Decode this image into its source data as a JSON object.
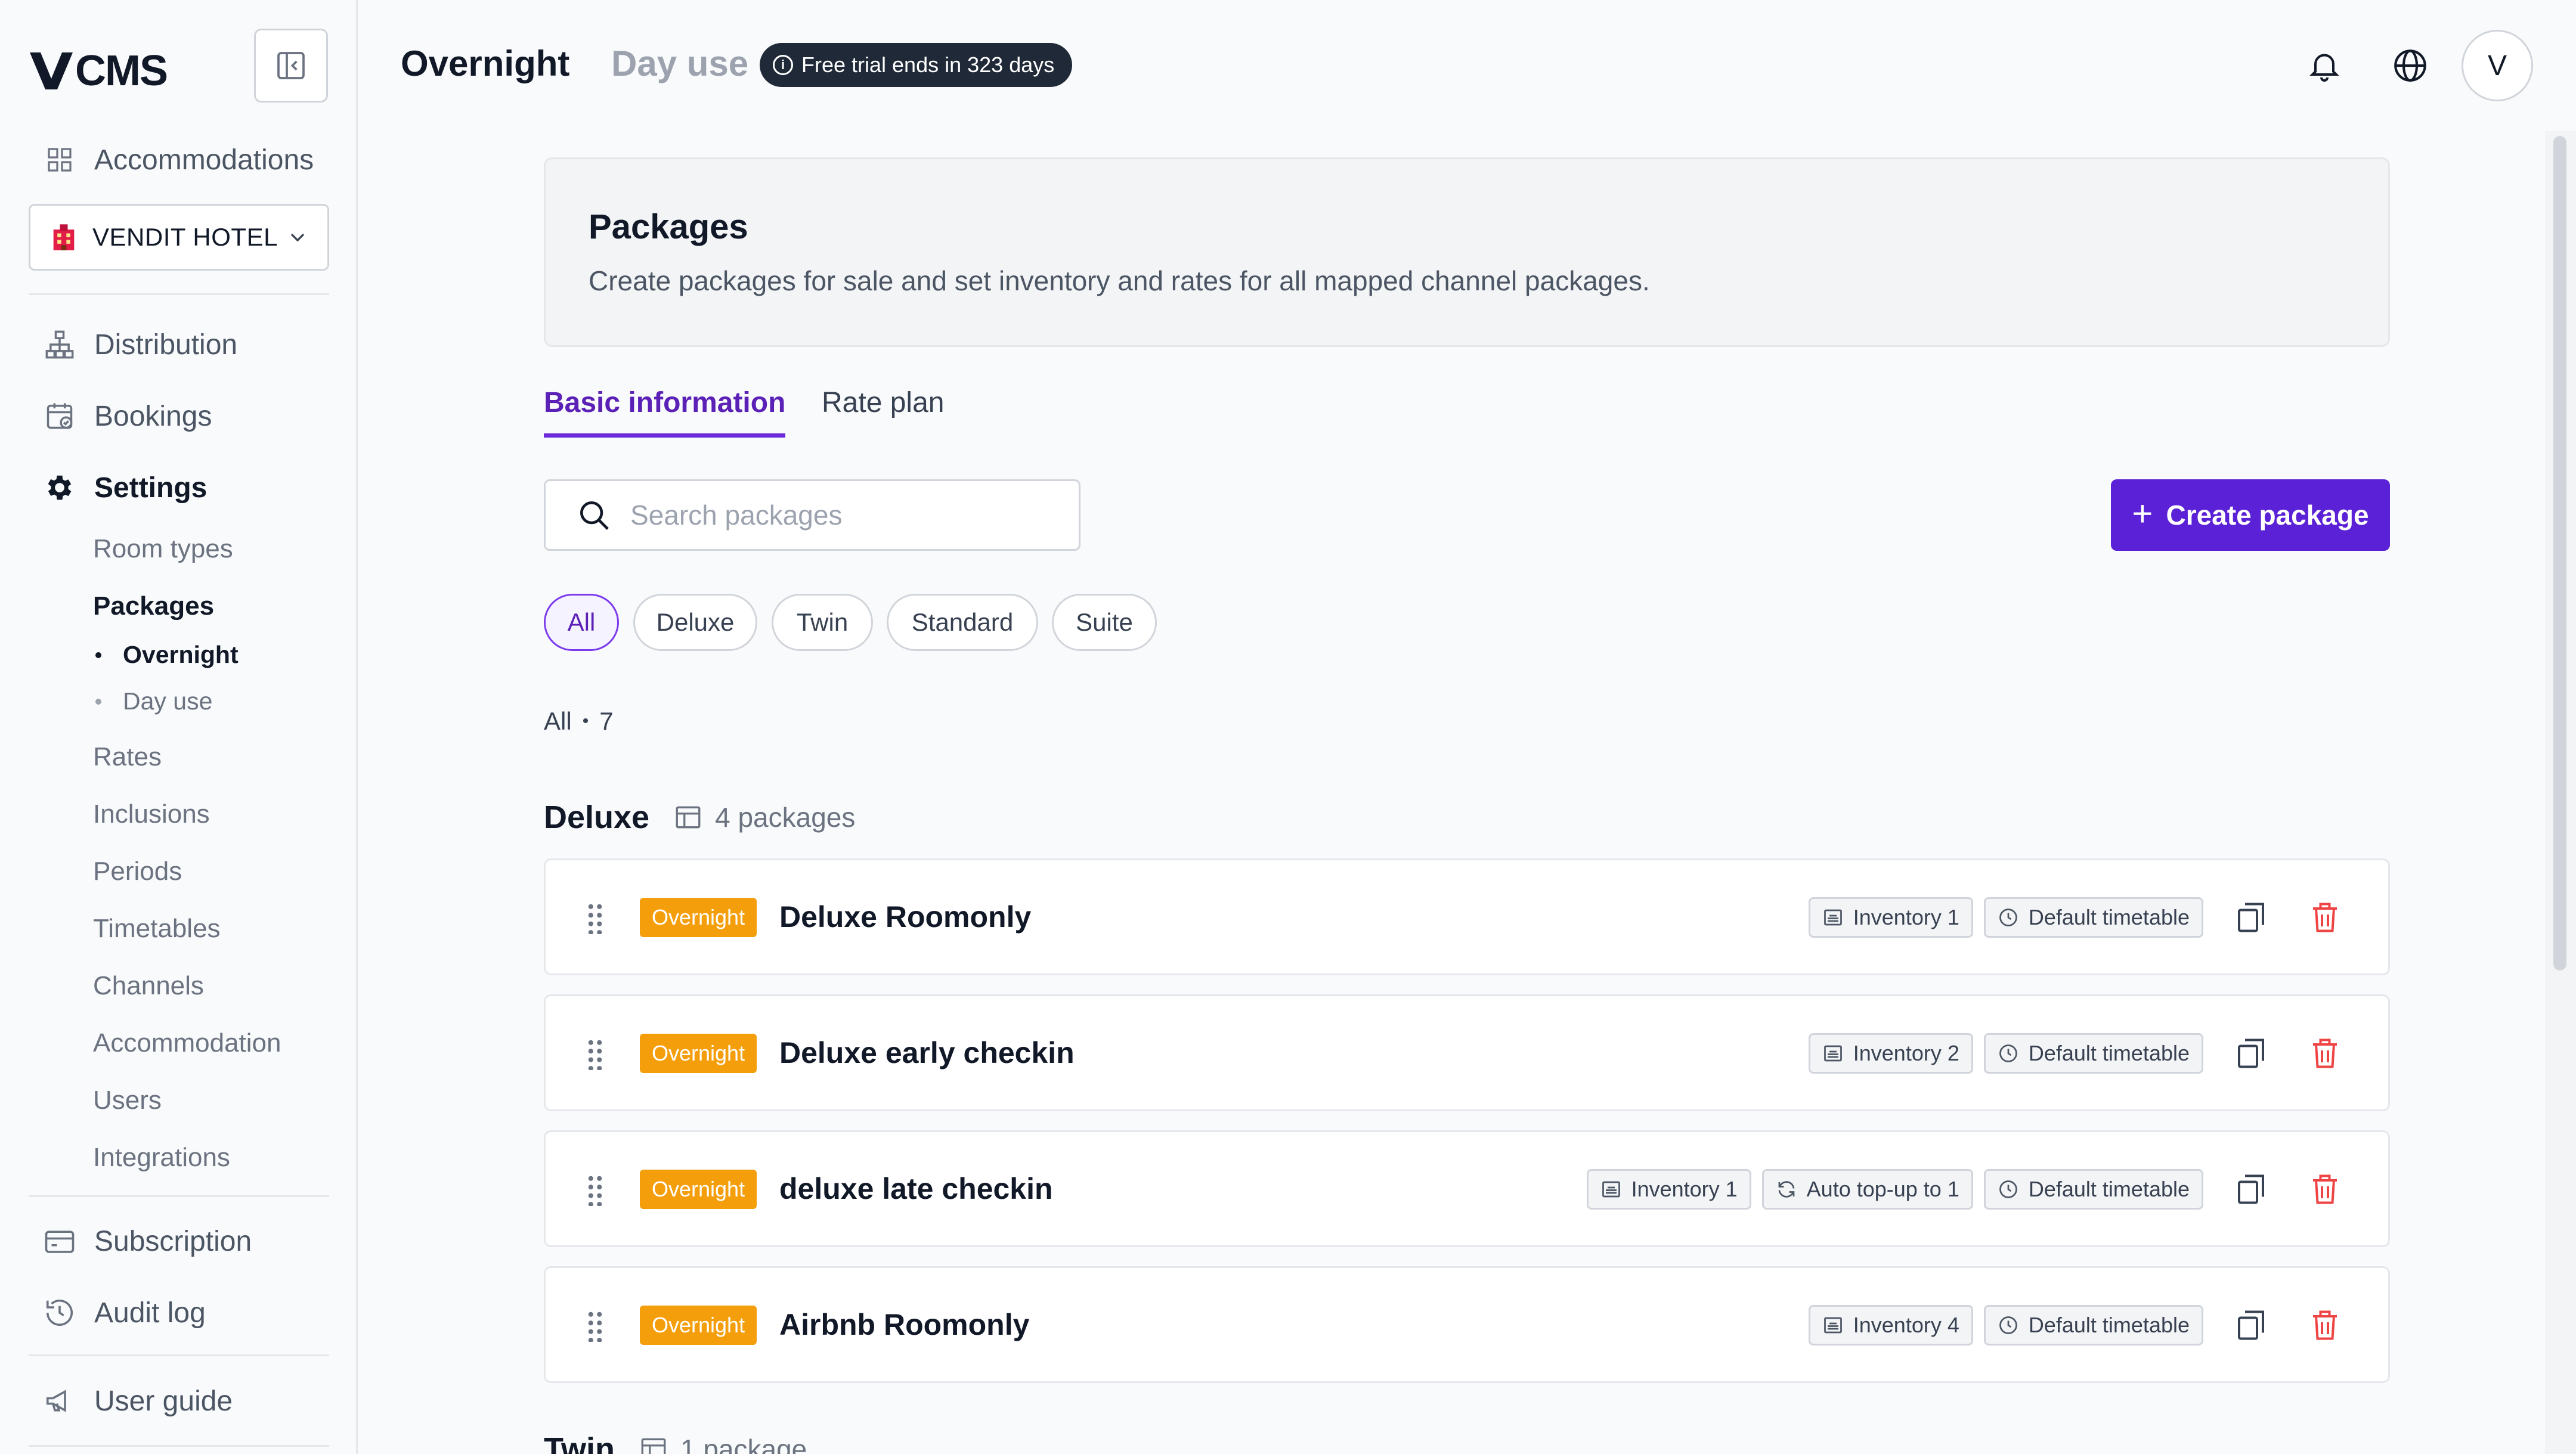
{
  "app": {
    "logo_text": "CMS"
  },
  "sidebar": {
    "accommodations_label": "Accommodations",
    "hotel_name": "VENDIT HOTEL",
    "nav": {
      "distribution": "Distribution",
      "bookings": "Bookings",
      "settings": "Settings",
      "subscription": "Subscription",
      "audit_log": "Audit log",
      "user_guide": "User guide"
    },
    "settings_items": {
      "room_types": "Room types",
      "packages": "Packages",
      "overnight": "Overnight",
      "day_use": "Day use",
      "rates": "Rates",
      "inclusions": "Inclusions",
      "periods": "Periods",
      "timetables": "Timetables",
      "channels": "Channels",
      "accommodation": "Accommodation",
      "users": "Users",
      "integrations": "Integrations"
    }
  },
  "header": {
    "tab_overnight": "Overnight",
    "tab_day_use": "Day use",
    "trial_badge": "Free trial ends in 323 days",
    "avatar_initial": "V"
  },
  "intro": {
    "title": "Packages",
    "description": "Create packages for sale and set inventory and rates for all mapped channel packages."
  },
  "content_tabs": {
    "basic": "Basic information",
    "rate_plan": "Rate plan"
  },
  "search": {
    "placeholder": "Search packages"
  },
  "create_button": "Create package",
  "filters": [
    "All",
    "Deluxe",
    "Twin",
    "Standard",
    "Suite"
  ],
  "count": {
    "label": "All",
    "value": "7"
  },
  "groups": [
    {
      "name": "Deluxe",
      "count_label": "4 packages",
      "packages": [
        {
          "badge": "Overnight",
          "name": "Deluxe Roomonly",
          "tags": [
            "Inventory 1",
            "Default timetable"
          ]
        },
        {
          "badge": "Overnight",
          "name": "Deluxe early checkin",
          "tags": [
            "Inventory 2",
            "Default timetable"
          ]
        },
        {
          "badge": "Overnight",
          "name": "deluxe late checkin",
          "tags": [
            "Inventory 1",
            "Auto top-up to 1",
            "Default timetable"
          ]
        },
        {
          "badge": "Overnight",
          "name": "Airbnb Roomonly",
          "tags": [
            "Inventory 4",
            "Default timetable"
          ]
        }
      ]
    },
    {
      "name": "Twin",
      "count_label": "1 package"
    }
  ],
  "colors": {
    "accent": "#5b21d6",
    "badge_overnight": "#f59e0b",
    "delete": "#ef4444"
  }
}
